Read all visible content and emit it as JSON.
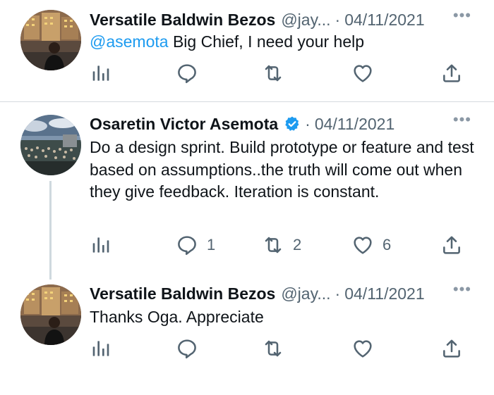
{
  "tweets": [
    {
      "name": "Versatile Baldwin Bezos",
      "handle": "@jay...",
      "separator": "·",
      "date": "04/11/2021",
      "more": "•••",
      "mention": "@asemota",
      "body": " Big Chief, I need your help",
      "counts": {
        "reply": "",
        "retweet": "",
        "like": ""
      }
    },
    {
      "name": "Osaretin Victor Asemota",
      "verified": true,
      "separator": "·",
      "date": "04/11/2021",
      "more": "•••",
      "body": "Do a design sprint. Build prototype or feature and test based on assumptions..the truth will come out when they give feedback. Iteration is constant.",
      "counts": {
        "reply": "1",
        "retweet": "2",
        "like": "6"
      }
    },
    {
      "name": "Versatile Baldwin Bezos",
      "handle": "@jay...",
      "separator": "·",
      "date": "04/11/2021",
      "more": "•••",
      "body": "Thanks Oga. Appreciate",
      "counts": {
        "reply": "",
        "retweet": "",
        "like": ""
      }
    }
  ],
  "icons": {
    "analytics": "analytics-icon",
    "reply": "reply-icon",
    "retweet": "retweet-icon",
    "like": "like-icon",
    "share": "share-icon",
    "verified": "verified-badge-icon"
  },
  "colors": {
    "text": "#0f1419",
    "secondary": "#536471",
    "mention": "#1d9bf0",
    "verified": "#1d9bf0",
    "divider": "#d5dadf"
  }
}
